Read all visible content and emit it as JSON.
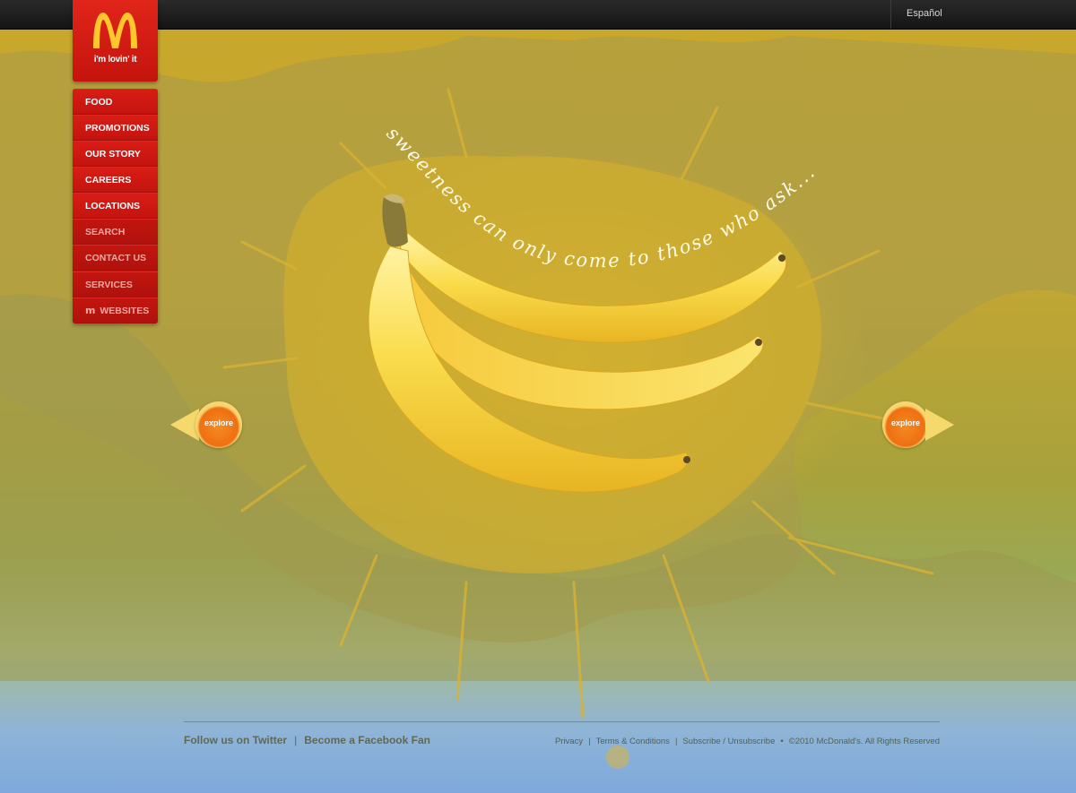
{
  "topbar": {
    "language_link": "Español"
  },
  "logo": {
    "tagline": "i'm lovin' it",
    "icon": "golden-arches-icon"
  },
  "nav": {
    "items": [
      {
        "label": "FOOD"
      },
      {
        "label": "PROMOTIONS"
      },
      {
        "label": "OUR STORY"
      },
      {
        "label": "CAREERS"
      },
      {
        "label": "LOCATIONS"
      },
      {
        "label": "SEARCH"
      },
      {
        "label": "CONTACT US"
      },
      {
        "label": "SERVICES"
      },
      {
        "label": "WEBSITES"
      }
    ]
  },
  "hero": {
    "headline": "sweetness can only come to those who ask...",
    "explore_left": "explore",
    "explore_right": "explore"
  },
  "footer": {
    "twitter": "Follow us on Twitter",
    "separator": "|",
    "facebook": "Become a Facebook Fan",
    "privacy": "Privacy",
    "terms": "Terms & Conditions",
    "subscribe": "Subscribe / Unsubscribe",
    "bullet": "•",
    "copyright": "©2010 McDonald's. All Rights Reserved"
  },
  "colors": {
    "brand_red": "#d81d16",
    "arch_yellow": "#ffc72c",
    "background_yellow": "#c9a82a",
    "explore_orange": "#ef6f12"
  }
}
